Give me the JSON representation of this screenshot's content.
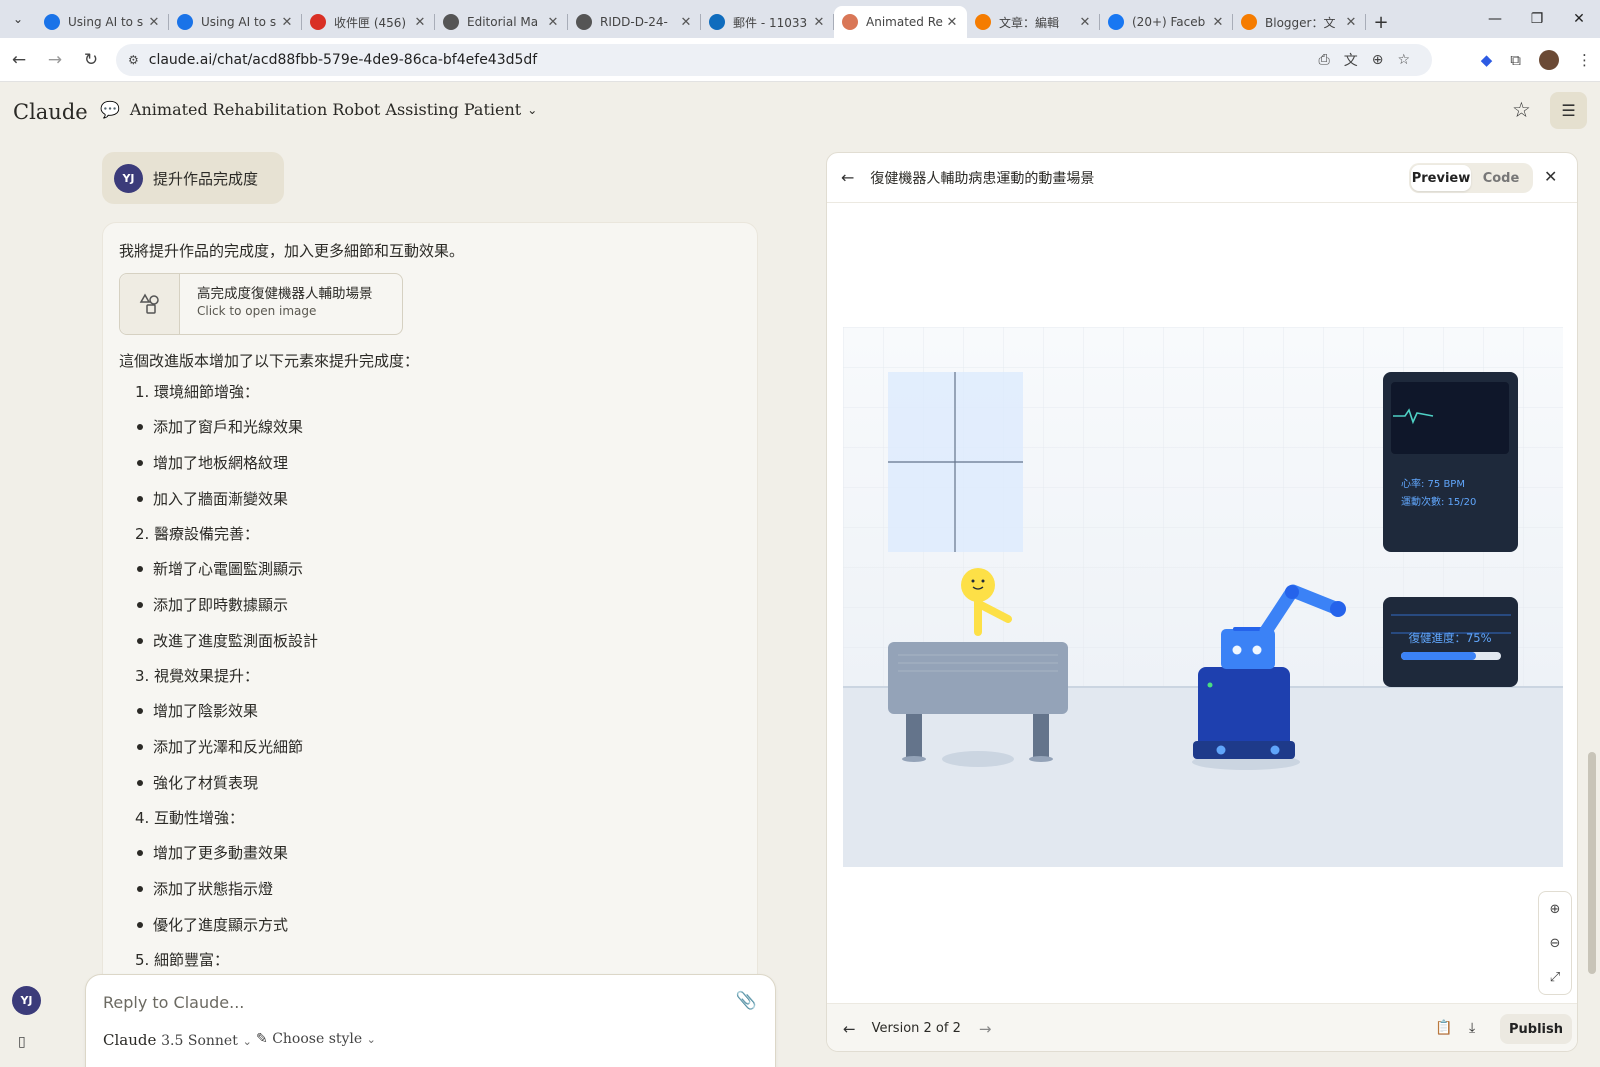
{
  "browser": {
    "tabs": [
      {
        "label": "Using AI to s",
        "icon": "chat-favicon",
        "color": "#1a73e8",
        "active": false
      },
      {
        "label": "Using AI to s",
        "icon": "chat-favicon",
        "color": "#1a73e8",
        "active": false
      },
      {
        "label": "收件匣 (456)",
        "icon": "gmail-favicon",
        "color": "#d93025",
        "active": false
      },
      {
        "label": "Editorial Ma",
        "icon": "globe-favicon",
        "color": "#555555",
        "active": false
      },
      {
        "label": "RIDD-D-24-",
        "icon": "globe-favicon",
        "color": "#555555",
        "active": false
      },
      {
        "label": "郵件 - 11033",
        "icon": "outlook-favicon",
        "color": "#0f6cbd",
        "active": false
      },
      {
        "label": "Animated Re",
        "icon": "claude-favicon",
        "color": "#d97757",
        "active": true
      },
      {
        "label": "文章：編輯",
        "icon": "blogger-favicon",
        "color": "#f57c00",
        "active": false
      },
      {
        "label": "(20+) Faceb",
        "icon": "facebook-favicon",
        "color": "#1877f2",
        "active": false
      },
      {
        "label": "Blogger：文",
        "icon": "blogger-favicon",
        "color": "#f57c00",
        "active": false
      }
    ],
    "url": "claude.ai/chat/acd88fbb-579e-4de9-86ca-bf4efe43d5df"
  },
  "app": {
    "brand": "Claude",
    "conversation_title": "Animated Rehabilitation Robot Assisting Patient"
  },
  "user_message": {
    "avatar": "YJ",
    "text": "提升作品完成度"
  },
  "response": {
    "intro": "我將提升作品的完成度，加入更多細節和互動效果。",
    "artifact_card": {
      "title": "高完成度復健機器人輔助場景",
      "subtitle": "Click to open image"
    },
    "lead": "這個改進版本增加了以下元素來提升完成度：",
    "sections": [
      {
        "num": "1.",
        "title": "環境細節增強：",
        "items": [
          "添加了窗戶和光線效果",
          "增加了地板網格紋理",
          "加入了牆面漸變效果"
        ]
      },
      {
        "num": "2.",
        "title": "醫療設備完善：",
        "items": [
          "新增了心電圖監測顯示",
          "添加了即時數據顯示",
          "改進了進度監測面板設計"
        ]
      },
      {
        "num": "3.",
        "title": "視覺效果提升：",
        "items": [
          "增加了陰影效果",
          "添加了光澤和反光細節",
          "強化了材質表現"
        ]
      },
      {
        "num": "4.",
        "title": "互動性增強：",
        "items": [
          "增加了更多動畫效果",
          "添加了狀態指示燈",
          "優化了進度顯示方式"
        ]
      },
      {
        "num": "5.",
        "title": "細節豐富：",
        "items": []
      }
    ]
  },
  "composer": {
    "placeholder": "Reply to Claude...",
    "model_name": "Claude",
    "model_version": "3.5 Sonnet",
    "style_label": "Choose style"
  },
  "artifact": {
    "title": "復健機器人輔助病患運動的動畫場景",
    "toggle_preview": "Preview",
    "toggle_code": "Code",
    "version_label": "Version 2 of 2",
    "publish_label": "Publish",
    "scene": {
      "heart_rate": "心率: 75 BPM",
      "exercise_count": "運動次數: 15/20",
      "progress_label": "復健進度：75%",
      "progress_value": 0.75,
      "accent": "#3b82f6",
      "monitor_bg": "#1e293b",
      "ecg_color": "#4fd1c5"
    }
  }
}
